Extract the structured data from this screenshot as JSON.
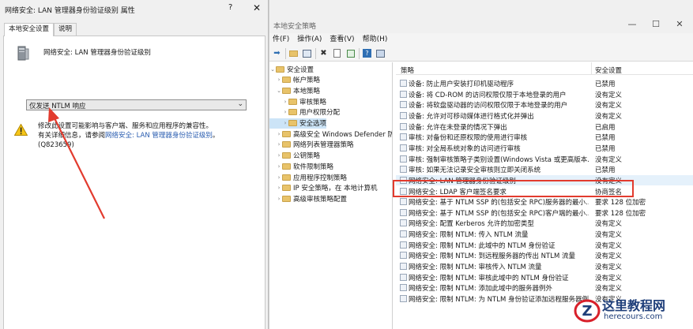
{
  "background_window": {
    "title": "本地安全策略",
    "controls": {
      "minimize": "—",
      "maximize": "☐",
      "close": "✕"
    },
    "menu": [
      "件(F)",
      "操作(A)",
      "查看(V)",
      "帮助(H)"
    ],
    "tree": [
      {
        "label": "安全设置",
        "indent": 0,
        "expanded": true
      },
      {
        "label": "帐户策略",
        "indent": 1
      },
      {
        "label": "本地策略",
        "indent": 1,
        "expanded": true
      },
      {
        "label": "审核策略",
        "indent": 2
      },
      {
        "label": "用户权限分配",
        "indent": 2
      },
      {
        "label": "安全选项",
        "indent": 2,
        "selected": true
      },
      {
        "label": "高级安全 Windows Defender 防火墙",
        "indent": 1
      },
      {
        "label": "网络列表管理器策略",
        "indent": 1
      },
      {
        "label": "公钥策略",
        "indent": 1
      },
      {
        "label": "软件限制策略",
        "indent": 1
      },
      {
        "label": "应用程序控制策略",
        "indent": 1
      },
      {
        "label": "IP 安全策略，在 本地计算机",
        "indent": 1
      },
      {
        "label": "高级审核策略配置",
        "indent": 1
      }
    ],
    "list": {
      "col_policy": "策略",
      "col_setting": "安全设置",
      "rows": [
        {
          "name": "设备: 防止用户安装打印机驱动程序",
          "value": "已禁用"
        },
        {
          "name": "设备: 将 CD-ROM 的访问权限仅限于本地登录的用户",
          "value": "没有定义"
        },
        {
          "name": "设备: 将软盘驱动器的访问权限仅限于本地登录的用户",
          "value": "没有定义"
        },
        {
          "name": "设备: 允许对可移动媒体进行格式化并弹出",
          "value": "没有定义"
        },
        {
          "name": "设备: 允许在未登录的情况下弹出",
          "value": "已启用"
        },
        {
          "name": "审核: 对备份和还原权限的使用进行审核",
          "value": "已禁用"
        },
        {
          "name": "审核: 对全局系统对象的访问进行审核",
          "value": "已禁用"
        },
        {
          "name": "审核: 强制审核策略子类别设置(Windows Vista 或更高版本...",
          "value": "没有定义"
        },
        {
          "name": "审核: 如果无法记录安全审核则立即关闭系统",
          "value": "已禁用"
        },
        {
          "name": "网络安全: LAN 管理器身份验证级别",
          "value": "没有定义",
          "highlight": true
        },
        {
          "name": "网络安全: LDAP 客户端签名要求",
          "value": "协商签名"
        },
        {
          "name": "网络安全: 基于 NTLM SSP 的(包括安全 RPC)服务器的最小...",
          "value": "要求 128 位加密"
        },
        {
          "name": "网络安全: 基于 NTLM SSP 的(包括安全 RPC)客户端的最小...",
          "value": "要求 128 位加密"
        },
        {
          "name": "网络安全: 配置 Kerberos 允许的加密类型",
          "value": "没有定义"
        },
        {
          "name": "网络安全: 限制 NTLM: 传入 NTLM 流量",
          "value": "没有定义"
        },
        {
          "name": "网络安全: 限制 NTLM: 此域中的 NTLM 身份验证",
          "value": "没有定义"
        },
        {
          "name": "网络安全: 限制 NTLM: 到远程服务器的传出 NTLM 流量",
          "value": "没有定义"
        },
        {
          "name": "网络安全: 限制 NTLM: 审核传入 NTLM 流量",
          "value": "没有定义"
        },
        {
          "name": "网络安全: 限制 NTLM: 审核此域中的 NTLM 身份验证",
          "value": "没有定义"
        },
        {
          "name": "网络安全: 限制 NTLM: 添加此域中的服务器例外",
          "value": "没有定义"
        },
        {
          "name": "网络安全: 限制 NTLM: 为 NTLM 身份验证添加远程服务器例外",
          "value": "没有定义"
        }
      ]
    }
  },
  "dialog": {
    "title": "网络安全: LAN 管理器身份验证级别 属性",
    "help": "?",
    "close": "✕",
    "tabs": [
      "本地安全设置",
      "说明"
    ],
    "policy_name": "网络安全: LAN 管理器身份验证级别",
    "dropdown_value": "仅发送 NTLM 响应",
    "warning_line1": "修改此设置可能影响与客户端、服务和应用程序的兼容性。",
    "warning_line2_prefix": "有关详细信息，请参阅",
    "warning_link": "网络安全: LAN 管理器身份验证级别",
    "warning_line2_suffix": "。",
    "warning_line3": "(Q823659)"
  },
  "watermark": {
    "title": "这里教程网",
    "url": "herecours.com"
  },
  "colors": {
    "highlight_box": "#e23b2e",
    "arrow": "#e23b2e",
    "link": "#2a5db0",
    "watermark": "#1f3f7a"
  }
}
